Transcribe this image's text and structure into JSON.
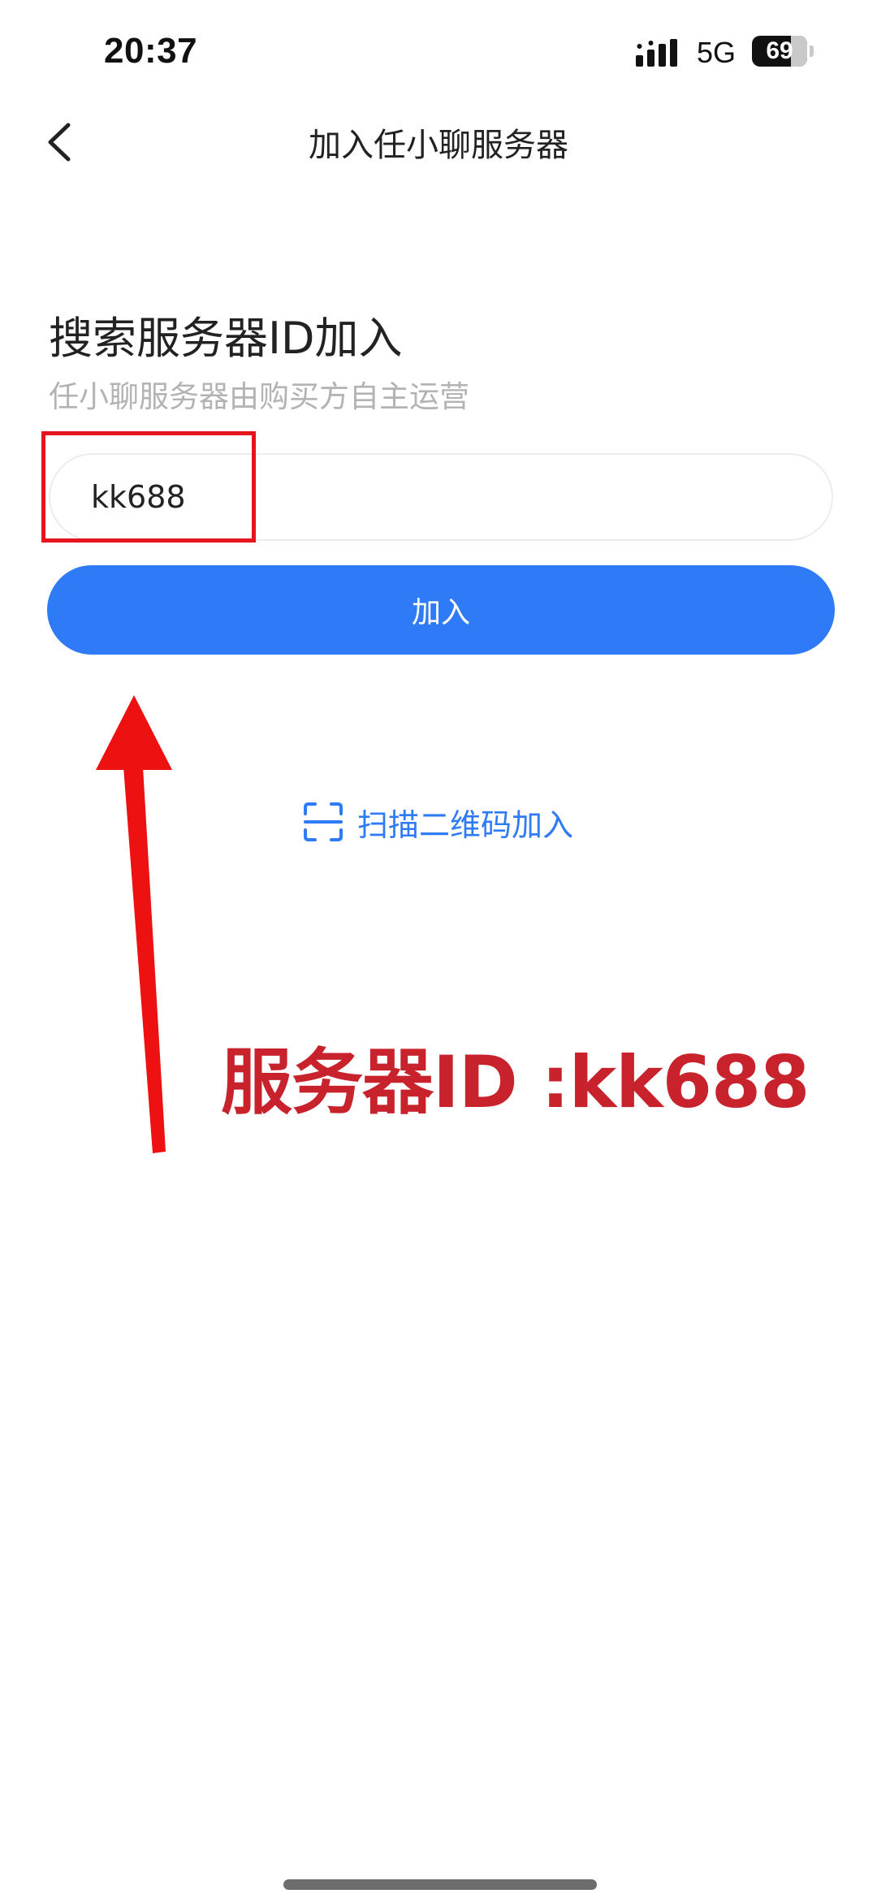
{
  "status_bar": {
    "time": "20:37",
    "network": "5G",
    "battery": "69"
  },
  "nav": {
    "title": "加入任小聊服务器",
    "back_icon": "chevron-left-icon"
  },
  "search": {
    "heading": "搜索服务器ID加入",
    "subtitle": "任小聊服务器由购买方自主运营",
    "input_value": "kk688"
  },
  "actions": {
    "join_label": "加入",
    "scan_label": "扫描二维码加入",
    "scan_icon": "qr-scan-icon"
  },
  "annotation": {
    "text": "服务器ID :kk688",
    "color": "#c8232d"
  },
  "colors": {
    "accent": "#2f7bf7",
    "highlight": "#e5141e"
  }
}
